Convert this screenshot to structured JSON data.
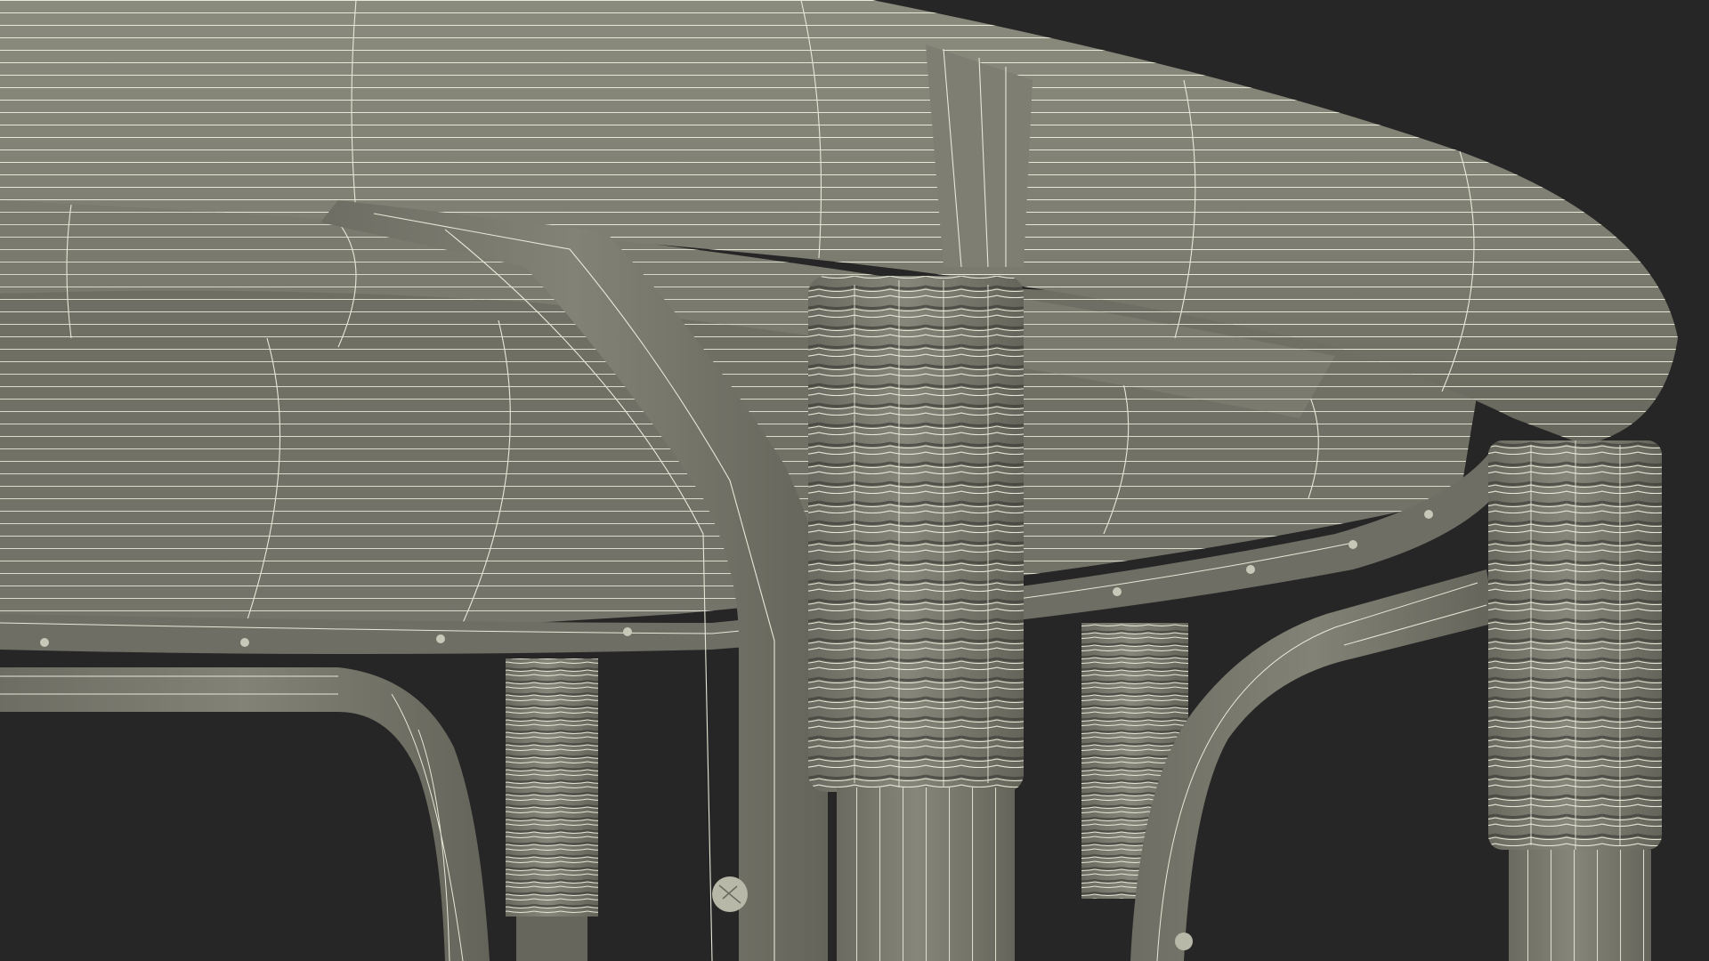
{
  "scene": {
    "subject": "wireframe-3d-render",
    "background_color": "#262626",
    "surface_color": "#7b7b6f",
    "surface_dark_color": "#5f5f55",
    "surface_light_color": "#8a8a7d",
    "wire_color": "#e8e8d8",
    "shadow_color": "#1c1c1c"
  }
}
